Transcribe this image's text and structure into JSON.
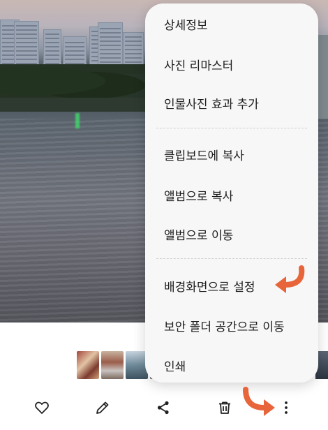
{
  "menu": {
    "items": [
      {
        "label": "상세정보"
      },
      {
        "label": "사진 리마스터"
      },
      {
        "label": "인물사진 효과 추가"
      },
      {
        "label": "클립보드에 복사"
      },
      {
        "label": "앨범으로 복사"
      },
      {
        "label": "앨범으로 이동"
      },
      {
        "label": "배경화면으로 설정"
      },
      {
        "label": "보안 폴더 공간으로 이동"
      },
      {
        "label": "인쇄"
      }
    ]
  },
  "toolbar": {
    "icons": [
      "heart-icon",
      "pencil-icon",
      "share-icon",
      "trash-icon",
      "more-vertical-icon"
    ]
  },
  "annotation": {
    "arrow_color": "#e8643a"
  }
}
